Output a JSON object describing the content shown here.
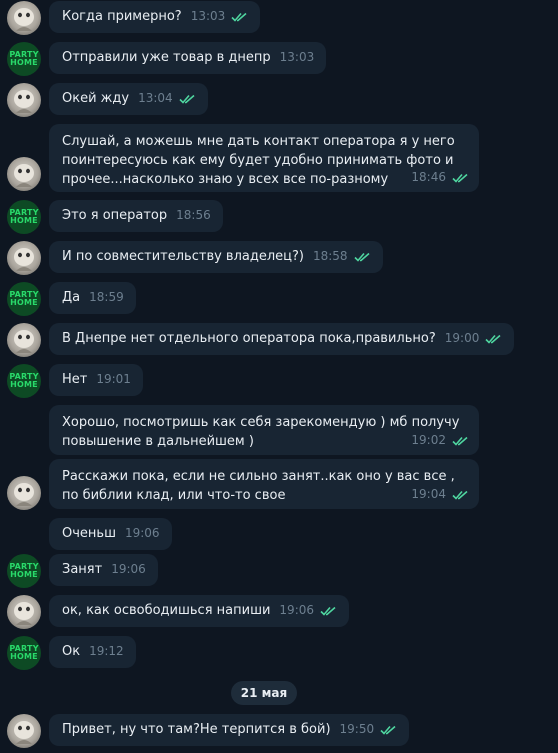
{
  "avatars": {
    "user_icon": "cat-avatar",
    "shop_icon": "party-home-logo",
    "shop_logo_line1": "PARTY",
    "shop_logo_line2": "HOME"
  },
  "messages": [
    {
      "text": "Когда примерно?",
      "time": "13:03",
      "read": true
    },
    {
      "text": "Отправили уже товар в днепр",
      "time": "13:03",
      "read": false
    },
    {
      "text": "Окей жду",
      "time": "13:04",
      "read": true
    },
    {
      "text": "Слушай, а можешь мне дать контакт оператора я у него пointересуюсь как ему будет удобно принимать фото и прочее...насколько знаю у всех все по-разному",
      "time": "18:46",
      "read": true
    },
    {
      "text": "Это я оператор",
      "time": "18:56",
      "read": false
    },
    {
      "text": "И по совместительству владелец?)",
      "time": "18:58",
      "read": true
    },
    {
      "text": "Да",
      "time": "18:59",
      "read": false
    },
    {
      "text": "В Днепре нет отдельного оператора пока,правильно?",
      "time": "19:00",
      "read": true
    },
    {
      "text": "Нет",
      "time": "19:01",
      "read": false
    },
    {
      "text": "Хорошо, посмотришь как себя зарекомендую ) мб получу повышение в дальнейшем )",
      "time": "19:02",
      "read": true
    },
    {
      "text": "Расскажи пока, если не сильно занят..как оно у вас все , по библии клад, или что-то свое",
      "time": "19:04",
      "read": true
    },
    {
      "text": "Оченьш",
      "time": "19:06",
      "read": false
    },
    {
      "text": "Занят",
      "time": "19:06",
      "read": false
    },
    {
      "text": "ок, как освободишься напиши",
      "time": "19:06",
      "read": true
    },
    {
      "text": "Ок",
      "time": "19:12",
      "read": false
    },
    {
      "text": "Привет, ну что там?Не терпится в бой)",
      "time": "19:50",
      "read": true
    }
  ],
  "date_separator": "21 мая",
  "colors": {
    "background": "#0e1621",
    "bubble": "#182533",
    "read_ticks": "#4fd6a0",
    "time": "#6d7f8f"
  }
}
